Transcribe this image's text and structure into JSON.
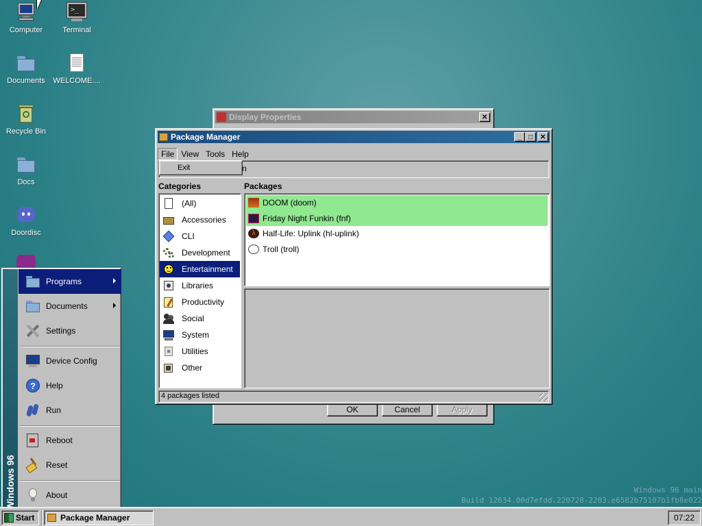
{
  "desktop": {
    "icons": [
      {
        "label": "Computer",
        "icon": "computer-icon"
      },
      {
        "label": "Terminal",
        "icon": "terminal-icon"
      },
      {
        "label": "Documents",
        "icon": "folder-icon"
      },
      {
        "label": "WELCOME....",
        "icon": "text-file-icon"
      },
      {
        "label": "Recycle Bin",
        "icon": "recycle-bin-icon"
      },
      {
        "label": "Docs",
        "icon": "folder-icon"
      },
      {
        "label": "Doordisc",
        "icon": "doordisc-icon"
      }
    ],
    "watermark": {
      "line1": "Windows 96 main",
      "line2": "Build 12634.00d7efdd.220728-2203.e6582b75107b1fb8e022"
    }
  },
  "display_properties": {
    "title": "Display Properties",
    "buttons": {
      "ok": "OK",
      "cancel": "Cancel",
      "apply": "Apply"
    },
    "fragment": "n"
  },
  "package_manager": {
    "title": "Package Manager",
    "menu": [
      "File",
      "View",
      "Tools",
      "Help"
    ],
    "file_menu": {
      "exit": "Exit"
    },
    "categories_header": "Categories",
    "packages_header": "Packages",
    "categories": [
      {
        "label": "(All)",
        "icon": "document-icon"
      },
      {
        "label": "Accessories",
        "icon": "toolbox-icon"
      },
      {
        "label": "CLI",
        "icon": "diamond-icon"
      },
      {
        "label": "Development",
        "icon": "gears-icon"
      },
      {
        "label": "Entertainment",
        "icon": "smiley-icon"
      },
      {
        "label": "Libraries",
        "icon": "library-icon"
      },
      {
        "label": "Productivity",
        "icon": "notepad-icon"
      },
      {
        "label": "Social",
        "icon": "people-icon"
      },
      {
        "label": "System",
        "icon": "monitor-icon"
      },
      {
        "label": "Utilities",
        "icon": "utility-icon"
      },
      {
        "label": "Other",
        "icon": "other-icon"
      }
    ],
    "selected_category": "Entertainment",
    "packages": [
      {
        "label": "DOOM (doom)",
        "icon": "doom-icon",
        "highlighted": true
      },
      {
        "label": "Friday Night Funkin (fnf)",
        "icon": "fnf-icon",
        "highlighted": true
      },
      {
        "label": "Half-Life: Uplink (hl-uplink)",
        "icon": "lambda-icon",
        "highlighted": false
      },
      {
        "label": "Troll (troll)",
        "icon": "troll-icon",
        "highlighted": false
      }
    ],
    "status": "4 packages listed"
  },
  "start_menu": {
    "banner": "Windows 96",
    "items": [
      {
        "label": "Programs",
        "icon": "folder-icon",
        "submenu": true
      },
      {
        "label": "Documents",
        "icon": "folder-icon",
        "submenu": true
      },
      {
        "label": "Settings",
        "icon": "settings-icon",
        "submenu": false
      },
      {
        "label": "Device Config",
        "icon": "monitor-icon",
        "submenu": false
      },
      {
        "label": "Help",
        "icon": "help-icon",
        "submenu": false
      },
      {
        "label": "Run",
        "icon": "run-icon",
        "submenu": false
      },
      {
        "label": "Reboot",
        "icon": "reboot-icon",
        "submenu": false
      },
      {
        "label": "Reset",
        "icon": "broom-icon",
        "submenu": false
      },
      {
        "label": "About",
        "icon": "lightbulb-icon",
        "submenu": false
      }
    ],
    "selected": "Programs"
  },
  "taskbar": {
    "start_label": "Start",
    "tasks": [
      {
        "label": "Package Manager",
        "icon": "package-icon"
      }
    ],
    "clock": "07:22"
  },
  "colors": {
    "desktop": "#2a7f86",
    "title_active": "#1a4b7c",
    "selection": "#0a1e7a",
    "package_highlight": "#90e890"
  }
}
